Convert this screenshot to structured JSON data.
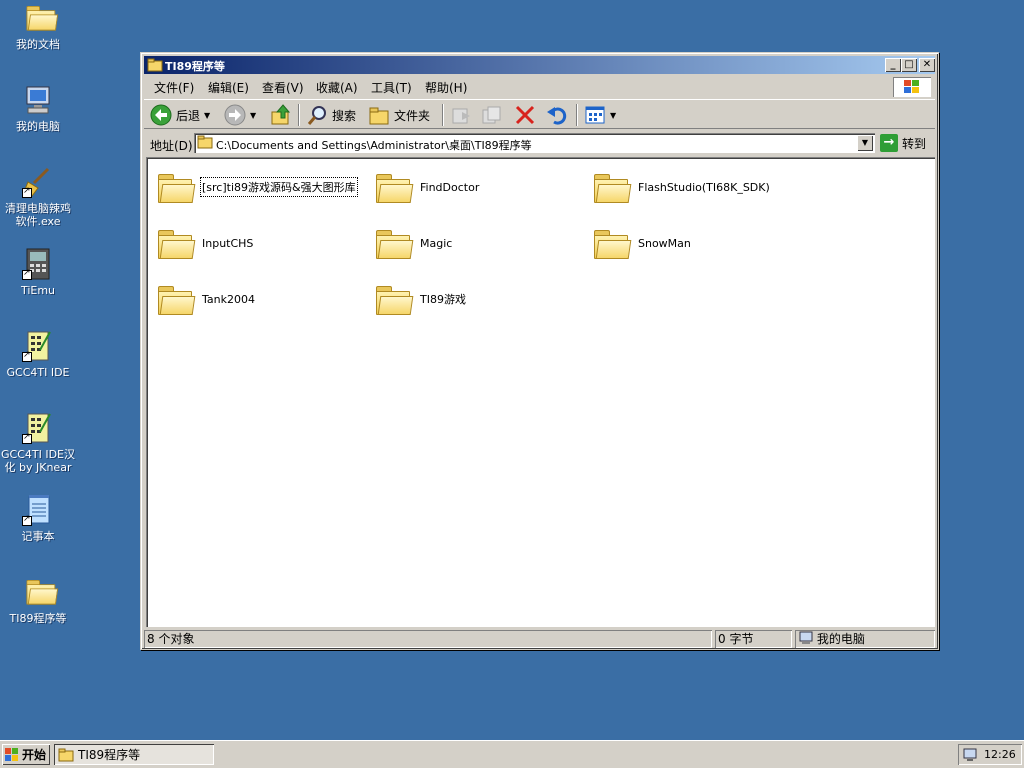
{
  "desktop": {
    "icons": [
      {
        "label": "我的文档"
      },
      {
        "label": "我的电脑"
      },
      {
        "label": "清理电脑辣鸡软件.exe"
      },
      {
        "label": "TiEmu"
      },
      {
        "label": "GCC4TI IDE"
      },
      {
        "label": "GCC4TI IDE汉化 by JKnear"
      },
      {
        "label": "记事本"
      },
      {
        "label": "TI89程序等"
      }
    ]
  },
  "window": {
    "title": "TI89程序等",
    "menu": [
      "文件(F)",
      "编辑(E)",
      "查看(V)",
      "收藏(A)",
      "工具(T)",
      "帮助(H)"
    ],
    "toolbar": {
      "back": "后退",
      "search": "搜索",
      "folders": "文件夹"
    },
    "address": {
      "label": "地址(D)",
      "value": "C:\\Documents and Settings\\Administrator\\桌面\\TI89程序等",
      "go": "转到"
    },
    "files": [
      {
        "name": "[src]ti89游戏源码&强大图形库",
        "selected": true
      },
      {
        "name": "FindDoctor"
      },
      {
        "name": "FlashStudio(TI68K_SDK)"
      },
      {
        "name": "InputCHS"
      },
      {
        "name": "Magic"
      },
      {
        "name": "SnowMan"
      },
      {
        "name": "Tank2004"
      },
      {
        "name": "TI89游戏"
      }
    ],
    "status": {
      "objects": "8 个对象",
      "size": "0 字节",
      "location": "我的电脑"
    }
  },
  "taskbar": {
    "start": "开始",
    "task": "TI89程序等",
    "clock": "12:26"
  }
}
